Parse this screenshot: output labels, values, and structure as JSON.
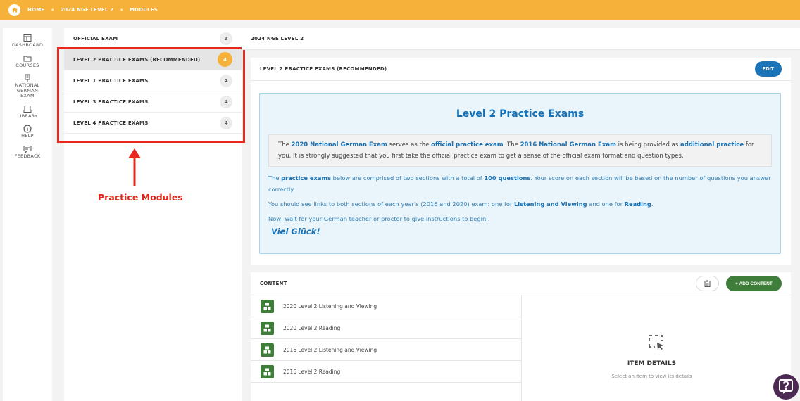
{
  "breadcrumb": {
    "home": "HOME",
    "level": "2024 NGE LEVEL 2",
    "modules": "MODULES"
  },
  "sidebar": {
    "items": [
      {
        "label": "DASHBOARD",
        "icon": "dashboard-icon"
      },
      {
        "label": "COURSES",
        "icon": "folder-icon"
      },
      {
        "label": "NATIONAL GERMAN EXAM",
        "icon": "exam-icon"
      },
      {
        "label": "LIBRARY",
        "icon": "library-icon"
      },
      {
        "label": "HELP",
        "icon": "info-icon"
      },
      {
        "label": "FEEDBACK",
        "icon": "feedback-icon"
      }
    ]
  },
  "modules": [
    {
      "label": "OFFICIAL EXAM",
      "count": "3"
    },
    {
      "label": "LEVEL 2 PRACTICE EXAMS (RECOMMENDED)",
      "count": "4",
      "active": true
    },
    {
      "label": "LEVEL 1 PRACTICE EXAMS",
      "count": "4"
    },
    {
      "label": "LEVEL 3 PRACTICE EXAMS",
      "count": "4"
    },
    {
      "label": "LEVEL 4 PRACTICE EXAMS",
      "count": "4"
    }
  ],
  "annotation": {
    "label": "Practice Modules",
    "color": "#e3261c"
  },
  "main": {
    "header": "2024 NGE LEVEL 2",
    "module_title": "LEVEL 2 PRACTICE EXAMS (RECOMMENDED)",
    "edit_label": "EDIT",
    "info": {
      "title": "Level 2 Practice Exams",
      "box": {
        "t1": "The ",
        "b1": "2020 National German Exam",
        "t2": " serves as the ",
        "b2": "official practice exam",
        "t3": ". The ",
        "b3": "2016 National German Exam",
        "t4": " is being provided as ",
        "b4": "additional practice",
        "t5": " for you. It is strongly suggested that you first take the official practice exam to get a sense of the official exam format and question types."
      },
      "p1": {
        "t1": "The ",
        "b1": "practice exams",
        "t2": " below are comprised of two sections with a total of ",
        "b2": "100 questions",
        "t3": ". Your score on each section will be based on the number of questions you answer correctly."
      },
      "p2": {
        "t1": "You should see links to both sections of each year's (2016 and 2020) exam: one for ",
        "b1": "Listening and Viewing",
        "t2": " and one for ",
        "b2": "Reading",
        "t3": "."
      },
      "p3": "Now, wait for your German teacher or proctor to give instructions to begin.",
      "closing": "Viel Glück!"
    },
    "content": {
      "title": "CONTENT",
      "add_label": "+ ADD CONTENT",
      "items": [
        "2020 Level 2 Listening and Viewing",
        "2020 Level 2 Reading",
        "2016 Level 2 Listening and Viewing",
        "2016 Level 2 Reading"
      ],
      "details_title": "ITEM DETAILS",
      "details_sub": "Select an item to view its details"
    }
  },
  "colors": {
    "accent_orange": "#f6b13a",
    "primary_blue": "#1b73b8",
    "green": "#3f7d3a",
    "help_purple": "#4d2a53"
  }
}
